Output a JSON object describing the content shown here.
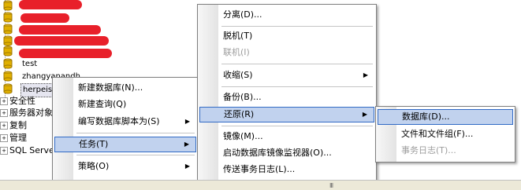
{
  "tree": {
    "databases": [
      {
        "label": ""
      },
      {
        "label": ""
      },
      {
        "label": ""
      },
      {
        "label": ""
      },
      {
        "label": "test"
      },
      {
        "label": "zhangyanandh"
      },
      {
        "label": "herpeis"
      }
    ],
    "folders": [
      "安全性",
      "服务器对象",
      "复制",
      "管理",
      "SQL Server"
    ]
  },
  "menu_main": {
    "items": [
      {
        "label": "新建数据库(N)..."
      },
      {
        "label": "新建查询(Q)"
      },
      {
        "label": "编写数据库脚本为(S)"
      },
      {
        "label": "任务(T)"
      },
      {
        "label": "策略(O)"
      }
    ]
  },
  "menu_tasks": {
    "items": [
      {
        "label": "分离(D)..."
      },
      {
        "label": "脱机(T)"
      },
      {
        "label": "联机(I)"
      },
      {
        "label": "收缩(S)"
      },
      {
        "label": "备份(B)..."
      },
      {
        "label": "还原(R)"
      },
      {
        "label": "镜像(M)..."
      },
      {
        "label": "启动数据库镜像监视器(O)..."
      },
      {
        "label": "传送事务日志(L)..."
      }
    ]
  },
  "menu_restore": {
    "items": [
      {
        "label": "数据库(D)..."
      },
      {
        "label": "文件和文件组(F)..."
      },
      {
        "label": "事务日志(T)..."
      }
    ]
  },
  "scrollbar": {
    "grip": "III"
  },
  "colors": {
    "highlight_bg": "#c1d2ee",
    "highlight_border": "#316ac5",
    "redaction": "#e8202a",
    "db_icon": "#e0b000"
  }
}
